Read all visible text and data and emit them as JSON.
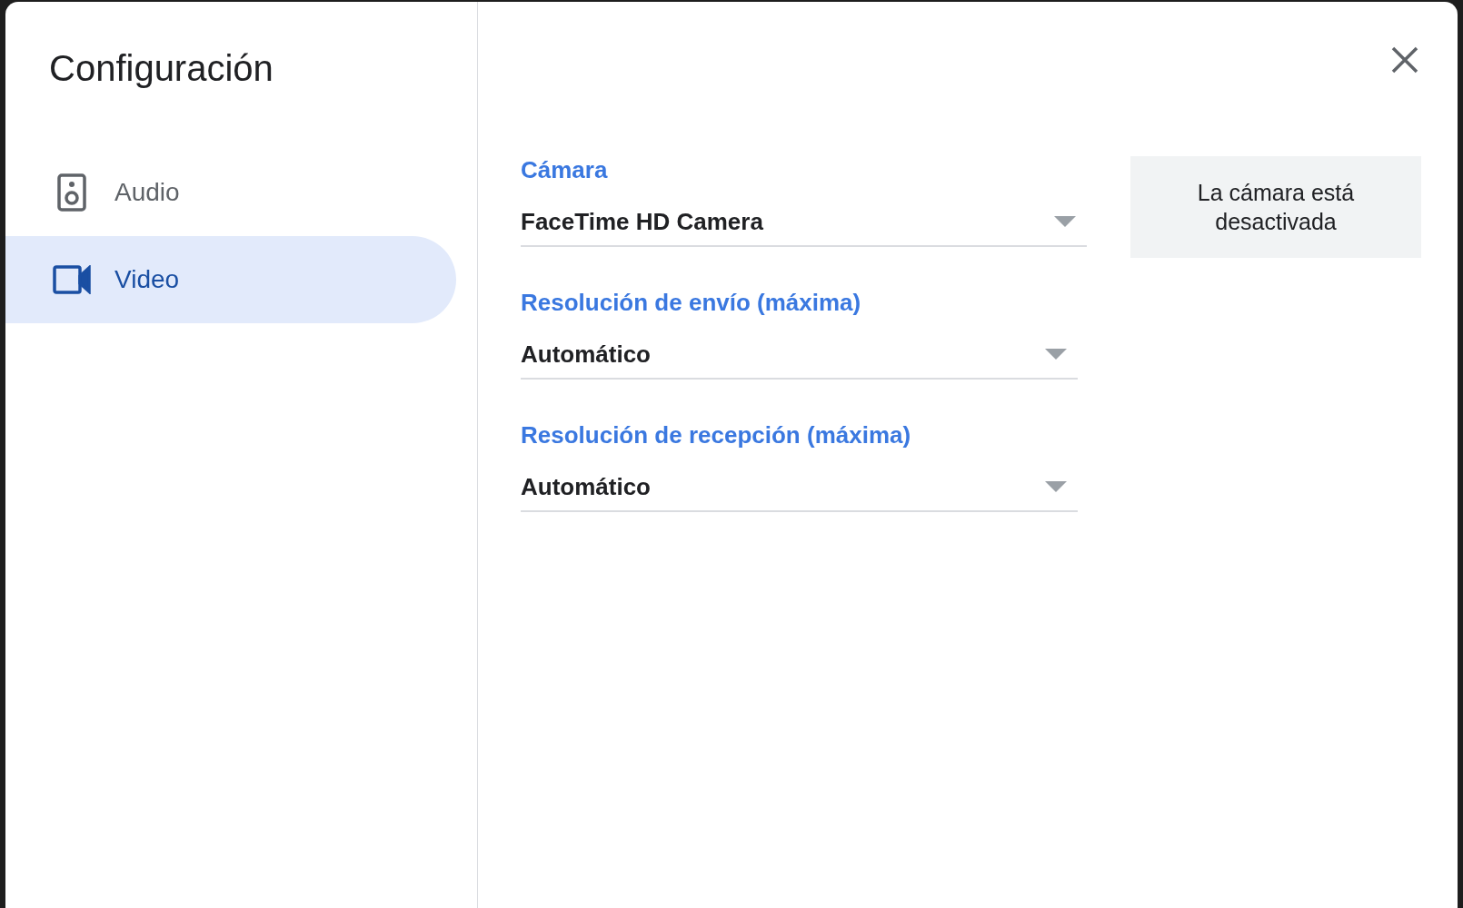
{
  "dialog": {
    "title": "Configuración"
  },
  "sidebar": {
    "items": [
      {
        "kind": "speaker",
        "label": "Audio",
        "selected": false
      },
      {
        "kind": "camera",
        "label": "Video",
        "selected": true
      }
    ]
  },
  "fields": [
    {
      "label": "Cámara",
      "value": "FaceTime HD Camera"
    },
    {
      "label": "Resolución de envío (máxima)",
      "value": "Automático"
    },
    {
      "label": "Resolución de recepción (máxima)",
      "value": "Automático"
    }
  ],
  "preview": {
    "text": "La cámara está desactivada"
  }
}
